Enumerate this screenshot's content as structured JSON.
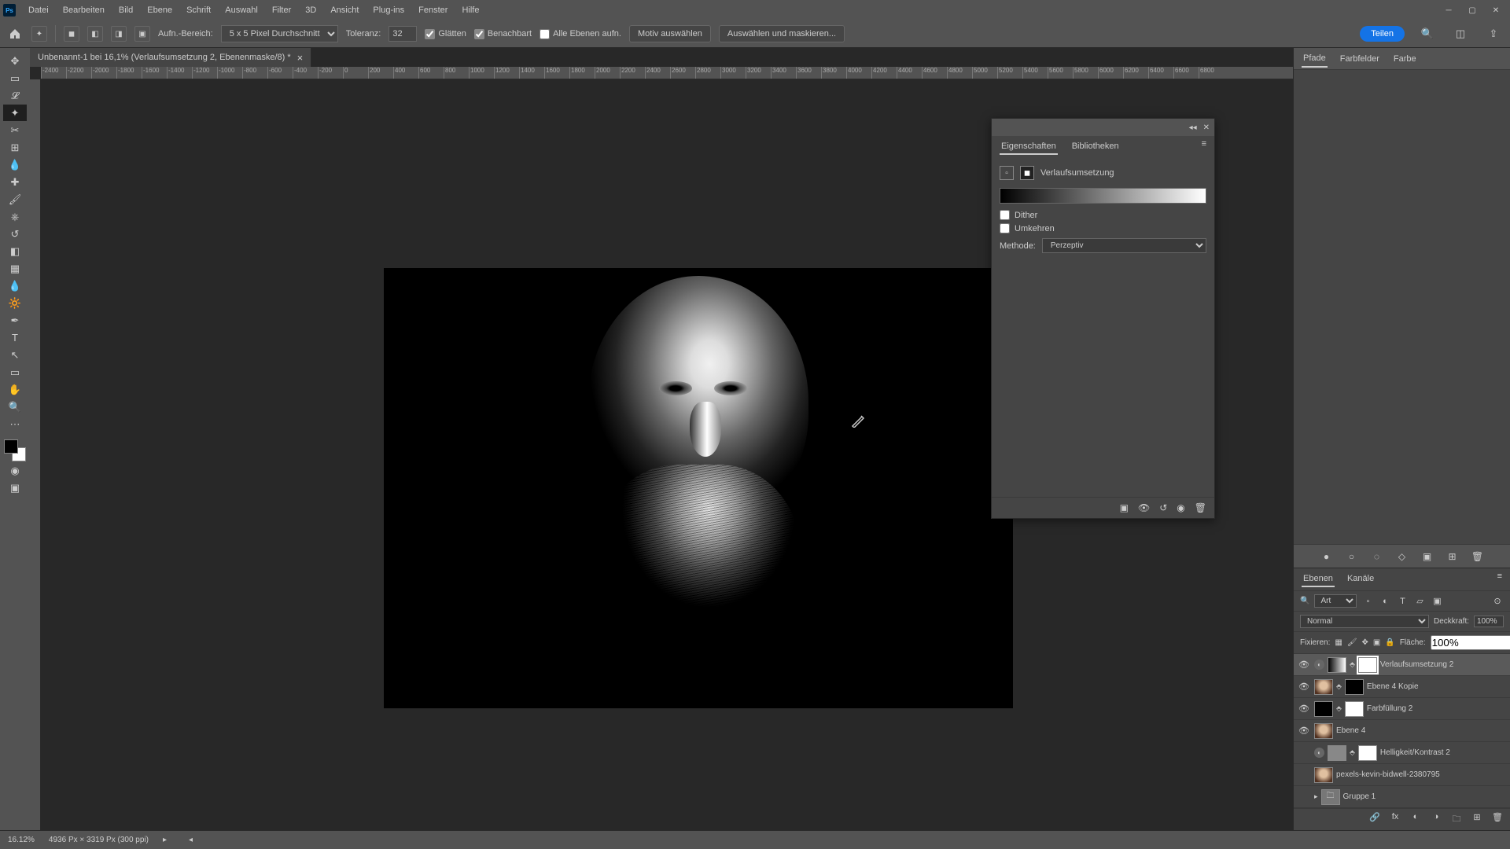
{
  "menu": {
    "items": [
      "Datei",
      "Bearbeiten",
      "Bild",
      "Ebene",
      "Schrift",
      "Auswahl",
      "Filter",
      "3D",
      "Ansicht",
      "Plug-ins",
      "Fenster",
      "Hilfe"
    ]
  },
  "optbar": {
    "sample_label": "Aufn.-Bereich:",
    "sample_value": "5 x 5 Pixel Durchschnitt",
    "tol_label": "Toleranz:",
    "tol_value": "32",
    "anti": "Glätten",
    "contig": "Benachbart",
    "all_layers": "Alle Ebenen aufn.",
    "select_subject": "Motiv auswählen",
    "select_mask": "Auswählen und maskieren...",
    "share": "Teilen"
  },
  "doc": {
    "title": "Unbenannt-1 bei 16,1% (Verlaufsumsetzung 2, Ebenenmaske/8) *"
  },
  "ruler": [
    "-2400",
    "-2200",
    "-2000",
    "-1800",
    "-1600",
    "-1400",
    "-1200",
    "-1000",
    "-800",
    "-600",
    "-400",
    "-200",
    "0",
    "200",
    "400",
    "600",
    "800",
    "1000",
    "1200",
    "1400",
    "1600",
    "1800",
    "2000",
    "2200",
    "2400",
    "2600",
    "2800",
    "3000",
    "3200",
    "3400",
    "3600",
    "3800",
    "4000",
    "4200",
    "4400",
    "4600",
    "4800",
    "5000",
    "5200",
    "5400",
    "5600",
    "5800",
    "6000",
    "6200",
    "6400",
    "6600",
    "6800"
  ],
  "dock": {
    "tabs": [
      "Pfade",
      "Farbfelder",
      "Farbe"
    ]
  },
  "props": {
    "tabs": [
      "Eigenschaften",
      "Bibliotheken"
    ],
    "type": "Verlaufsumsetzung",
    "dither": "Dither",
    "reverse": "Umkehren",
    "method_label": "Methode:",
    "method_value": "Perzeptiv"
  },
  "layers": {
    "tabs": [
      "Ebenen",
      "Kanäle"
    ],
    "kind": "Art",
    "blend": "Normal",
    "opacity_label": "Deckkraft:",
    "opacity": "100%",
    "lock_label": "Fixieren:",
    "fill_label": "Fläche:",
    "fill": "100%",
    "items": [
      {
        "vis": true,
        "fx": true,
        "thumb": "grad",
        "mask": "white",
        "sel": true,
        "name": "Verlaufsumsetzung 2"
      },
      {
        "vis": true,
        "fx": false,
        "thumb": "face",
        "mask": "black",
        "sel": false,
        "name": "Ebene 4 Kopie"
      },
      {
        "vis": true,
        "fx": false,
        "thumb": "black",
        "mask": "white",
        "sel": false,
        "name": "Farbfüllung 2"
      },
      {
        "vis": true,
        "fx": false,
        "thumb": "face",
        "mask": null,
        "sel": false,
        "name": "Ebene 4"
      },
      {
        "vis": false,
        "fx": true,
        "thumb": "adj",
        "mask": "white",
        "sel": false,
        "name": "Helligkeit/Kontrast 2"
      },
      {
        "vis": false,
        "fx": false,
        "thumb": "face",
        "mask": null,
        "sel": false,
        "name": "pexels-kevin-bidwell-2380795"
      },
      {
        "vis": false,
        "fx": false,
        "thumb": "folder",
        "mask": null,
        "sel": false,
        "name": "Gruppe 1"
      }
    ]
  },
  "status": {
    "zoom": "16.12%",
    "doc": "4936 Px × 3319 Px (300 ppi)"
  }
}
